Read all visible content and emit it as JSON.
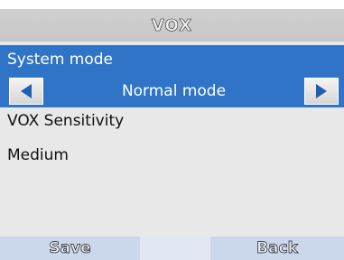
{
  "title": "VOX",
  "highlight_item": {
    "label": "System mode",
    "value": "Normal mode",
    "left_icon": "arrow-left-icon",
    "right_icon": "arrow-right-icon"
  },
  "items": [
    {
      "label": "VOX Sensitivity"
    },
    {
      "label": "Medium"
    }
  ],
  "softkeys": {
    "left": "Save",
    "right": "Back"
  },
  "colors": {
    "highlight": "#2f74c6",
    "background": "#e8e8e8",
    "softkey": "#cbd7ea"
  }
}
